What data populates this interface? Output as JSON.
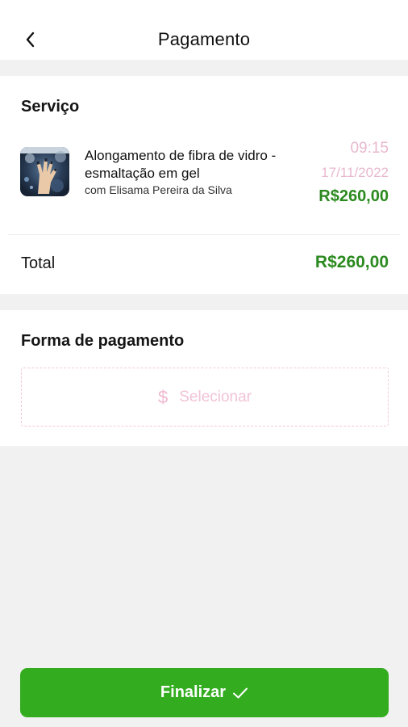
{
  "header": {
    "title": "Pagamento",
    "back_icon": "chevron-left-icon"
  },
  "service_section": {
    "title": "Serviço",
    "item": {
      "name": "Alongamento de fibra de vidro - esmaltação em gel",
      "professional": "com Elisama Pereira da Silva",
      "time": "09:15",
      "date": "17/11/2022",
      "price": "R$260,00"
    },
    "total_label": "Total",
    "total_value": "R$260,00"
  },
  "payment_section": {
    "title": "Forma de pagamento",
    "select_icon": "$",
    "select_label": "Selecionar"
  },
  "footer": {
    "finalize_label": "Finalizar",
    "finalize_icon": "checkmark-icon"
  },
  "colors": {
    "accent_green": "#33ad1f",
    "price_green": "#2b8a1f",
    "pink_muted": "#e8b8cf",
    "background": "#f1f1f1"
  }
}
